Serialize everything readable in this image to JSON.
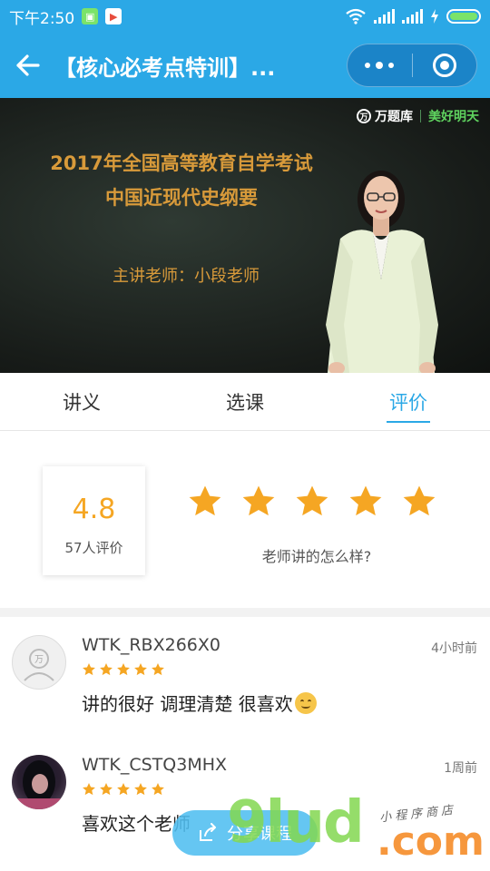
{
  "status_bar": {
    "time": "下午2:50",
    "app_icon_1": "sim-card-icon",
    "app_icon_2": "play-store-icon",
    "battery_color": "#7be36a"
  },
  "nav": {
    "title": "【核心必考点特训】...",
    "back_icon": "back-arrow-icon",
    "more_icon": "more-dots-icon",
    "close_icon": "target-circle-icon",
    "bar_color": "#2ba8e6"
  },
  "video": {
    "brand_1": "万题库",
    "brand_2": "美好明天",
    "title_line_1": "2017年全国高等教育自学考试",
    "title_line_2": "中国近现代史纲要",
    "teacher": "主讲老师：小段老师"
  },
  "tabs": [
    {
      "label": "讲义",
      "active": false
    },
    {
      "label": "选课",
      "active": false
    },
    {
      "label": "评价",
      "active": true
    }
  ],
  "rating": {
    "score": "4.8",
    "count_label": "57人评价",
    "stars": 5,
    "prompt": "老师讲的怎么样?",
    "star_color": "#f5a623"
  },
  "comments": [
    {
      "username": "WTK_RBX266X0",
      "time": "4小时前",
      "stars": 5,
      "text": "讲的很好 调理清楚 很喜欢",
      "emoji": "smiling-face-emoji",
      "avatar": "default-avatar-icon"
    },
    {
      "username": "WTK_CSTQ3MHX",
      "time": "1周前",
      "stars": 5,
      "text": "喜欢这个老师",
      "avatar": "user-photo-avatar"
    }
  ],
  "share": {
    "label": "分享课程",
    "icon": "share-icon"
  },
  "watermark": {
    "main": "9lud",
    "suffix": ".com",
    "sub": "小程序商店"
  }
}
